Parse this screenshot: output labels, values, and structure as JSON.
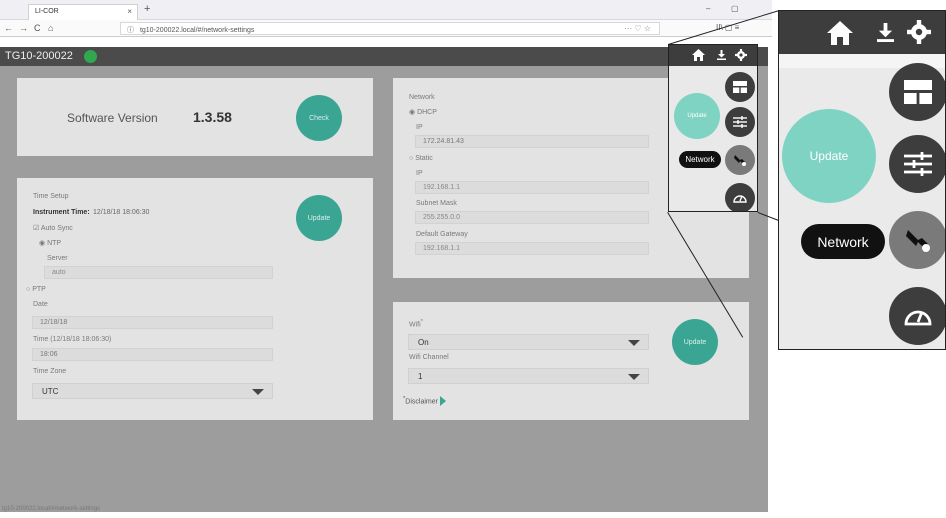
{
  "browser": {
    "tab_title": "LI-COR",
    "tab_close": "×",
    "new_tab": "+",
    "minimize": "–",
    "maximize": "▢",
    "url": "tg10-200022.local/#/network-settings",
    "url_info_icon": "ⓘ",
    "page_actions": "··· ♡ ☆",
    "nav_back": "←",
    "nav_forward": "→",
    "nav_reload": "C",
    "nav_home": "⌂",
    "toolbar_right": "II\\  ▢  ≡",
    "status_url": "tg10-200022.local/#/network-settings"
  },
  "header": {
    "title": "TG10-200022",
    "status_color": "#2fa84f"
  },
  "software": {
    "label": "Software Version",
    "version": "1.3.58",
    "check_button": "Check"
  },
  "time_setup": {
    "section_title": "Time Setup",
    "instrument_time_label": "Instrument Time:",
    "instrument_time_value": "12/18/18 18:06:30",
    "auto_sync_label": "Auto Sync",
    "ntp_label": "NTP",
    "server_label": "Server",
    "server_value": "auto",
    "ptp_label": "PTP",
    "date_label": "Date",
    "date_value": "12/18/18",
    "time_label": "Time (12/18/18 18:06:30)",
    "time_value": "18:06",
    "timezone_label": "Time Zone",
    "timezone_value": "UTC",
    "update_button": "Update"
  },
  "network": {
    "section_title": "Network",
    "dhcp_label": "DHCP",
    "dhcp_ip_label": "IP",
    "dhcp_ip_value": "172.24.81.43",
    "static_label": "Static",
    "static_ip_label": "IP",
    "static_ip_value": "192.168.1.1",
    "subnet_label": "Subnet Mask",
    "subnet_value": "255.255.0.0",
    "gateway_label": "Default Gateway",
    "gateway_value": "192.168.1.1"
  },
  "wifi": {
    "wifi_label": "Wifi",
    "wifi_asterisk": "*",
    "wifi_value": "On",
    "channel_label": "Wifi Channel",
    "channel_value": "1",
    "disclaimer_label": "Disclaimer",
    "update_button": "Update"
  },
  "side_menu": {
    "update_button": "Update",
    "network_label": "Network",
    "icons": [
      "home-icon",
      "download-icon",
      "gear-icon",
      "dashboard-icon",
      "sliders-icon",
      "wrench-icon",
      "gauge-icon"
    ]
  },
  "colors": {
    "accent": "#3aa592",
    "accent_light": "#7fd3c3",
    "dark": "#3d3d3d",
    "status_green": "#2fa84f"
  }
}
